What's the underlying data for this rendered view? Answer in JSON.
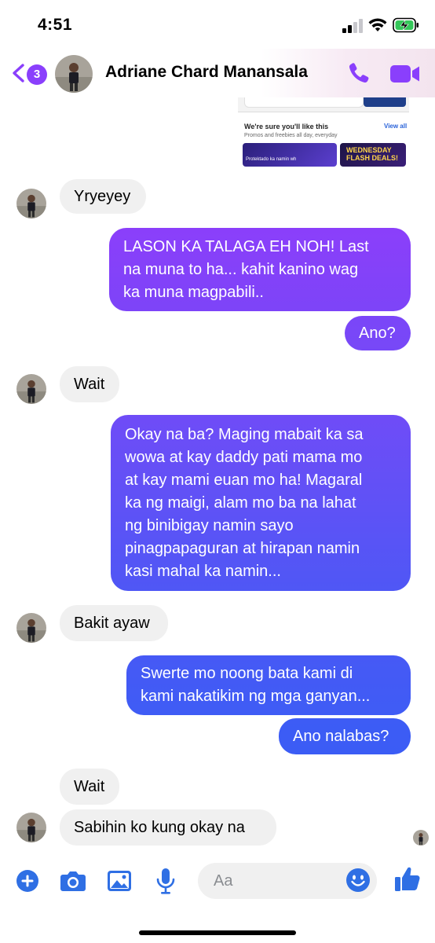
{
  "status_bar": {
    "time": "4:51"
  },
  "header": {
    "unread_count": "3",
    "contact_name": "Adriane Chard Manansala"
  },
  "shared_image": {
    "heading": "We're sure you'll like this",
    "subheading": "Promos and freebies all day, everyday",
    "view_all": "View all",
    "banner_text": "Protektado ka namin wh",
    "banner_2_line_1": "WEDNESDAY",
    "banner_2_line_2": "FLASH DEALS!"
  },
  "messages": [
    {
      "direction": "in",
      "lines": [
        "Yryeyey"
      ]
    },
    {
      "direction": "out",
      "lines": [
        "LASON KA TALAGA EH NOH! Last",
        "na muna to ha... kahit kanino wag",
        "ka muna magpabili.."
      ]
    },
    {
      "direction": "out",
      "lines": [
        "Ano?"
      ]
    },
    {
      "direction": "in",
      "lines": [
        "Wait"
      ]
    },
    {
      "direction": "out",
      "lines": [
        "Okay na ba? Maging mabait ka sa",
        "wowa at kay daddy pati mama mo",
        "at kay mami euan mo ha! Magaral",
        "ka ng maigi, alam mo ba na lahat",
        "ng binibigay namin sayo",
        "pinagpapaguran at hirapan namin",
        "kasi mahal ka namin..."
      ]
    },
    {
      "direction": "in",
      "lines": [
        "Bakit ayaw"
      ]
    },
    {
      "direction": "out",
      "lines": [
        "Swerte mo noong bata kami di",
        "kami nakatikim ng mga ganyan..."
      ]
    },
    {
      "direction": "out",
      "lines": [
        "Ano nalabas?"
      ]
    },
    {
      "direction": "in",
      "lines": [
        "Wait"
      ]
    },
    {
      "direction": "in",
      "lines": [
        "Sabihin ko kung okay na"
      ]
    }
  ],
  "composer": {
    "placeholder": "Aa"
  },
  "colors": {
    "accent": "#8a3ffc",
    "bubble_in": "#f0f0f0",
    "bubble_out_top": "#8a3ffc",
    "bubble_out_bottom": "#3b5bf5"
  }
}
